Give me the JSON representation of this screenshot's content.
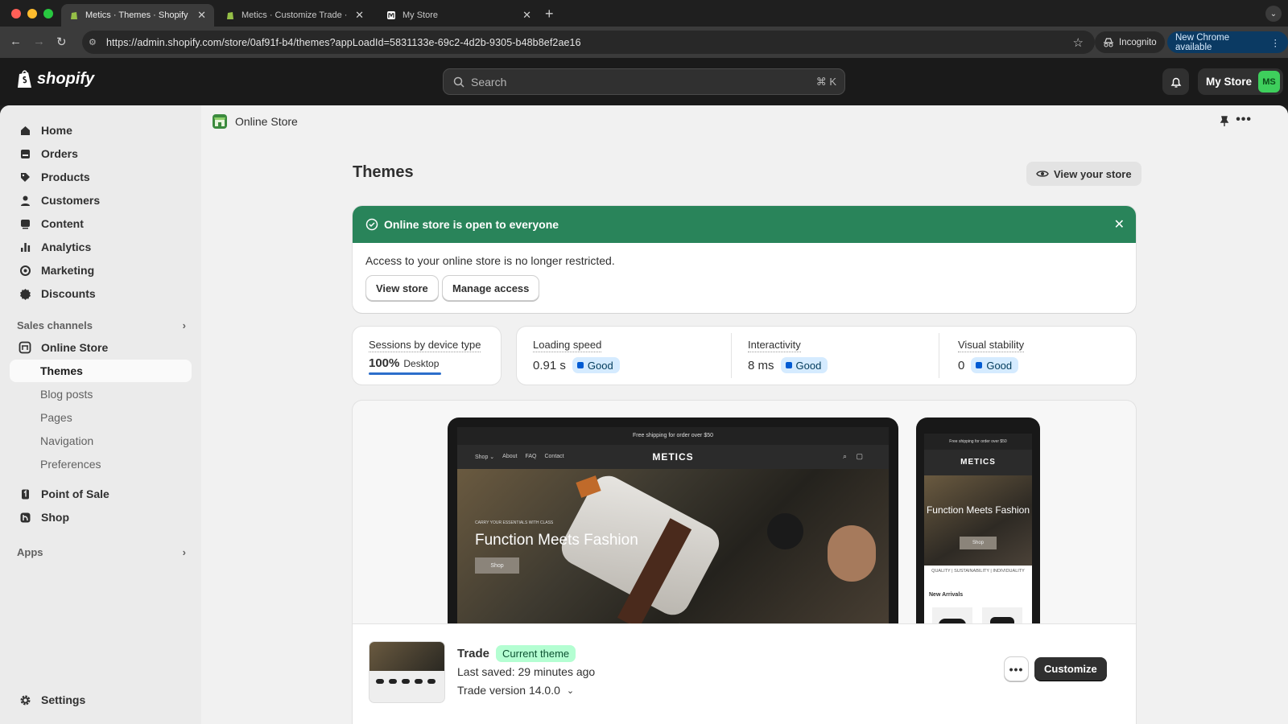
{
  "browser": {
    "tabs": [
      {
        "title": "Metics · Themes · Shopify",
        "active": true
      },
      {
        "title": "Metics · Customize Trade · Sh",
        "active": false
      },
      {
        "title": "My Store",
        "active": false
      }
    ],
    "url": "https://admin.shopify.com/store/0af91f-b4/themes?appLoadId=5831133e-69c2-4d2b-9305-b48b8ef2ae16",
    "incognito_label": "Incognito",
    "update_label": "New Chrome available"
  },
  "topbar": {
    "logo_text": "shopify",
    "search_placeholder": "Search",
    "search_shortcut": "⌘ K",
    "store_name": "My Store",
    "avatar_initials": "MS"
  },
  "sidebar": {
    "items": [
      {
        "label": "Home",
        "icon": "home-icon"
      },
      {
        "label": "Orders",
        "icon": "orders-icon"
      },
      {
        "label": "Products",
        "icon": "tag-icon"
      },
      {
        "label": "Customers",
        "icon": "person-icon"
      },
      {
        "label": "Content",
        "icon": "content-icon"
      },
      {
        "label": "Analytics",
        "icon": "bar-chart-icon"
      },
      {
        "label": "Marketing",
        "icon": "target-icon"
      },
      {
        "label": "Discounts",
        "icon": "discount-icon"
      }
    ],
    "sales_channels_label": "Sales channels",
    "online_store": "Online Store",
    "online_store_sub": [
      "Themes",
      "Blog posts",
      "Pages",
      "Navigation",
      "Preferences"
    ],
    "point_of_sale": "Point of Sale",
    "shop": "Shop",
    "apps_label": "Apps",
    "settings": "Settings"
  },
  "page": {
    "breadcrumb": "Online Store",
    "title": "Themes",
    "view_store_btn": "View your store"
  },
  "banner": {
    "title": "Online store is open to everyone",
    "body": "Access to your online store is no longer restricted.",
    "btn_view": "View store",
    "btn_manage": "Manage access",
    "color": "#29845a"
  },
  "metrics": {
    "sessions": {
      "label": "Sessions by device type",
      "percent": "100%",
      "device": "Desktop"
    },
    "loading": {
      "label": "Loading speed",
      "value": "0.91 s",
      "status": "Good"
    },
    "interactivity": {
      "label": "Interactivity",
      "value": "8 ms",
      "status": "Good"
    },
    "stability": {
      "label": "Visual stability",
      "value": "0",
      "status": "Good"
    }
  },
  "preview": {
    "announcement": "Free shipping for order over $50",
    "nav": [
      "Shop ⌄",
      "About",
      "FAQ",
      "Contact"
    ],
    "brand": "METICS",
    "hero_sub": "CARRY YOUR ESSENTIALS WITH CLASS",
    "hero_title": "Function Meets Fashion",
    "hero_btn": "Shop",
    "values": "QUALITY  |  SUSTAINABILITY  |  INDIVIDUALITY",
    "mobile_title": "Function Meets Fashion",
    "new_arrivals": "New Arrivals"
  },
  "theme": {
    "name": "Trade",
    "badge": "Current theme",
    "last_saved": "Last saved: 29 minutes ago",
    "version": "Trade version 14.0.0",
    "customize_btn": "Customize"
  }
}
